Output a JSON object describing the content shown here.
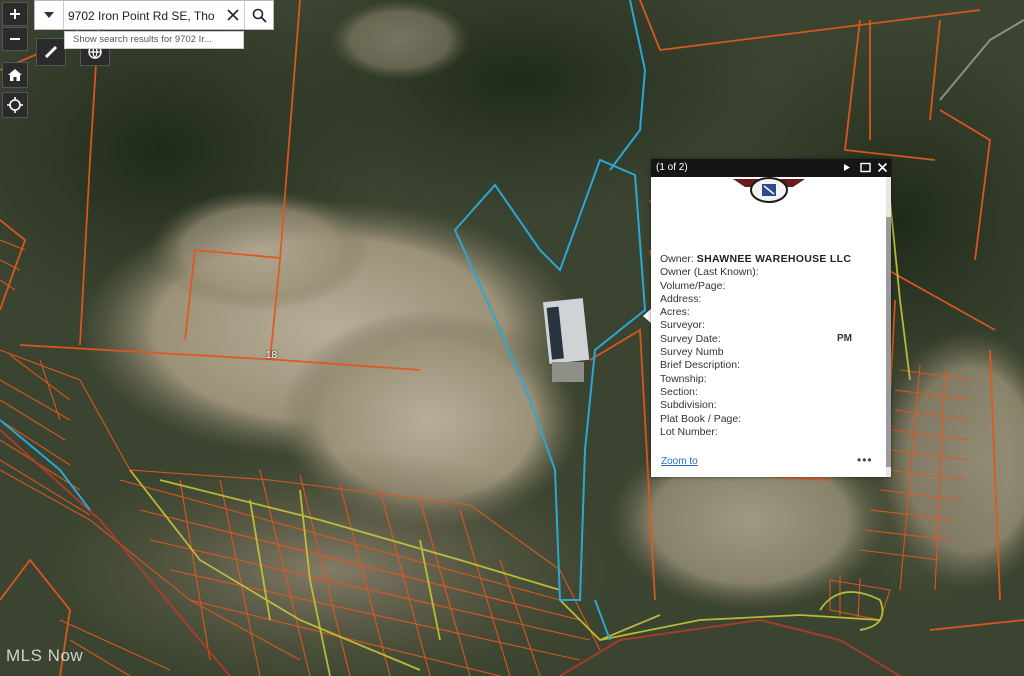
{
  "search": {
    "value": "9702 Iron Point Rd SE, Tho",
    "suggestion": "Show search results for 9702 Ir..."
  },
  "controls": {
    "zoom_in_icon": "plus-icon",
    "zoom_out_icon": "minus-icon",
    "home_icon": "home-icon",
    "locate_icon": "locate-icon",
    "measure_icon": "ruler-icon",
    "basemap_icon": "globe-icon"
  },
  "map": {
    "parcel_label": "18",
    "colors": {
      "parcel_lines": "#e0581e",
      "selected_parcel": "#2aa7d4",
      "road_lines": "#c7c63a",
      "terrain": "#3f4732"
    }
  },
  "popup": {
    "counter": "(1 of 2)",
    "rows": [
      {
        "label": "Owner:",
        "value": "SHAWNEE WAREHOUSE LLC"
      },
      {
        "label": "Owner (Last Known):",
        "value": ""
      },
      {
        "label": "Volume/Page:",
        "value": ""
      },
      {
        "label": "Address:",
        "value": ""
      },
      {
        "label": "Acres:",
        "value": ""
      },
      {
        "label": "Surveyor:",
        "value": ""
      },
      {
        "label": "Survey Date:",
        "value": ""
      },
      {
        "label": "Survey Numb",
        "value": ""
      },
      {
        "label": "Brief Description:",
        "value": ""
      },
      {
        "label": "Township:",
        "value": ""
      },
      {
        "label": "Section:",
        "value": ""
      },
      {
        "label": "Subdivision:",
        "value": ""
      },
      {
        "label": "Plat Book / Page:",
        "value": ""
      },
      {
        "label": "Lot Number:",
        "value": ""
      }
    ],
    "pm_fragment": "PM",
    "zoom_link": "Zoom to",
    "more": "•••"
  },
  "watermark": "MLS Now"
}
